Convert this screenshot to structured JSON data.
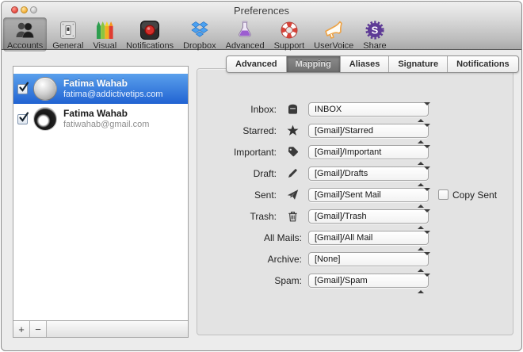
{
  "window": {
    "title": "Preferences"
  },
  "toolbar": {
    "items": [
      {
        "label": "Accounts",
        "icon": "accounts-icon",
        "selected": true
      },
      {
        "label": "General",
        "icon": "general-icon",
        "selected": false
      },
      {
        "label": "Visual",
        "icon": "visual-icon",
        "selected": false
      },
      {
        "label": "Notifications",
        "icon": "notifications-icon",
        "selected": false
      },
      {
        "label": "Dropbox",
        "icon": "dropbox-icon",
        "selected": false
      },
      {
        "label": "Advanced",
        "icon": "flask-icon",
        "selected": false
      },
      {
        "label": "Support",
        "icon": "lifebuoy-icon",
        "selected": false
      },
      {
        "label": "UserVoice",
        "icon": "megaphone-icon",
        "selected": false
      },
      {
        "label": "Share",
        "icon": "share-gear-icon",
        "badge": "S",
        "selected": false
      }
    ]
  },
  "tabs": {
    "items": [
      {
        "label": "Advanced",
        "selected": false
      },
      {
        "label": "Mapping",
        "selected": true
      },
      {
        "label": "Aliases",
        "selected": false
      },
      {
        "label": "Signature",
        "selected": false
      },
      {
        "label": "Notifications",
        "selected": false
      }
    ]
  },
  "accounts": {
    "items": [
      {
        "name": "Fatima Wahab",
        "email": "fatima@addictivetips.com",
        "checked": true,
        "selected": true
      },
      {
        "name": "Fatima Wahab",
        "email": "fatiwahab@gmail.com",
        "checked": true,
        "selected": false
      }
    ],
    "footer": {
      "add": "+",
      "remove": "−"
    }
  },
  "mapping": {
    "rows": [
      {
        "label": "Inbox:",
        "icon": "inbox-icon",
        "value": "INBOX"
      },
      {
        "label": "Starred:",
        "icon": "star-icon",
        "value": "[Gmail]/Starred"
      },
      {
        "label": "Important:",
        "icon": "tag-icon",
        "value": "[Gmail]/Important"
      },
      {
        "label": "Draft:",
        "icon": "pencil-icon",
        "value": "[Gmail]/Drafts"
      },
      {
        "label": "Sent:",
        "icon": "paper-plane-icon",
        "value": "[Gmail]/Sent Mail",
        "extra_checkbox": "Copy Sent",
        "extra_checked": false
      },
      {
        "label": "Trash:",
        "icon": "trash-icon",
        "value": "[Gmail]/Trash"
      },
      {
        "label": "All Mails:",
        "icon": null,
        "value": "[Gmail]/All Mail"
      },
      {
        "label": "Archive:",
        "icon": null,
        "value": "[None]"
      },
      {
        "label": "Spam:",
        "icon": null,
        "value": "[Gmail]/Spam"
      }
    ]
  },
  "colors": {
    "selection_blue_top": "#5aa0ec",
    "selection_blue_bottom": "#2163d2",
    "tab_selected_gray": "#7b7b7b",
    "record_red": "#c1211b",
    "dropbox_blue": "#3d8fe5",
    "flask_purple": "#9c5ed0",
    "lifebuoy_red": "#d84238",
    "uservoice_orange": "#eda245",
    "share_purple": "#5e3b96"
  }
}
